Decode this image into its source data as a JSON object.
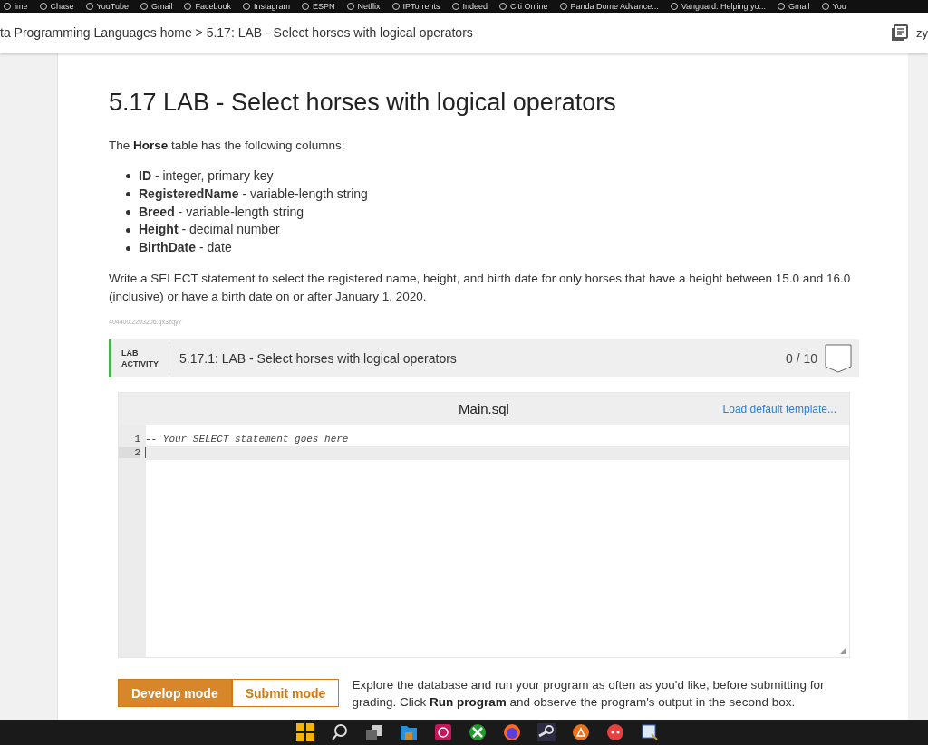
{
  "bookmarks": [
    {
      "label": "ime"
    },
    {
      "label": "Chase"
    },
    {
      "label": "YouTube"
    },
    {
      "label": "Gmail"
    },
    {
      "label": "Facebook"
    },
    {
      "label": "Instagram"
    },
    {
      "label": "ESPN"
    },
    {
      "label": "Netflix"
    },
    {
      "label": "IPTorrents"
    },
    {
      "label": "Indeed"
    },
    {
      "label": "Citi Online"
    },
    {
      "label": "Panda Dome Advance..."
    },
    {
      "label": "Vanguard: Helping yo..."
    },
    {
      "label": "Gmail"
    },
    {
      "label": "You"
    }
  ],
  "breadcrumb": {
    "text": "ta Programming Languages home > 5.17: LAB - Select horses with logical operators",
    "user": "zy"
  },
  "title": "5.17 LAB - Select horses with logical operators",
  "intro": "The **Horse** table has the following columns:",
  "columns": [
    "**ID** - integer, primary key",
    "**RegisteredName** - variable-length string",
    "**Breed** - variable-length string",
    "**Height** - decimal number",
    "**BirthDate** - date"
  ],
  "task": "Write a SELECT statement to select the registered name, height, and birth date for only horses that have a height between 15.0 and 16.0 (inclusive) or have a birth date on or after January 1, 2020.",
  "content_id": "404400.2293206.qx3zqy7",
  "lab": {
    "tag_line1": "LAB",
    "tag_line2": "ACTIVITY",
    "title": "5.17.1: LAB - Select horses with logical operators",
    "score": "0 / 10",
    "editor": {
      "filename": "Main.sql",
      "load_template": "Load default template...",
      "lines": [
        {
          "number": "1",
          "code": "-- Your SELECT statement goes here",
          "active": false
        },
        {
          "number": "2",
          "active": true
        }
      ]
    },
    "modes": [
      {
        "label": "Develop mode",
        "selected": true
      },
      {
        "label": "Submit mode",
        "selected": false
      }
    ],
    "mode_help": "Explore the database and run your program as often as you'd like, before submitting for grading. Click **Run program** and observe the program's output in the second box."
  }
}
